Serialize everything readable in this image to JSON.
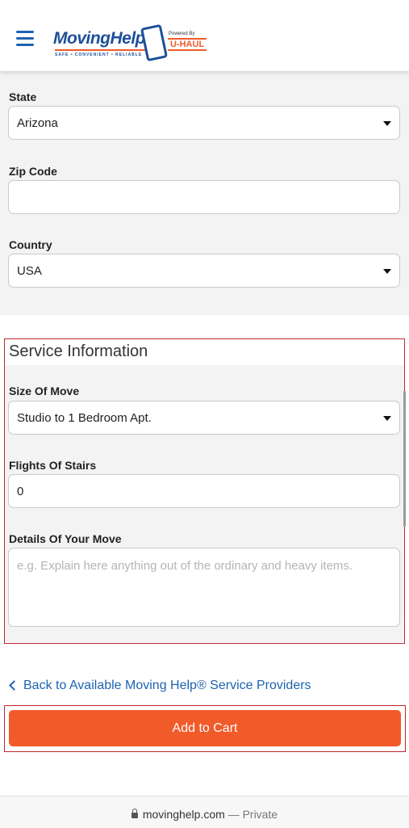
{
  "header": {
    "logo_text": "MovingHelp",
    "tagline": "SAFE • CONVENIENT • RELIABLE",
    "powered_by": "Powered By",
    "partner": "U-HAUL"
  },
  "address": {
    "state_label": "State",
    "state_value": "Arizona",
    "zip_label": "Zip Code",
    "zip_value": "",
    "country_label": "Country",
    "country_value": "USA"
  },
  "service": {
    "title": "Service Information",
    "size_label": "Size Of Move",
    "size_value": "Studio to 1 Bedroom Apt.",
    "stairs_label": "Flights Of Stairs",
    "stairs_value": "0",
    "details_label": "Details Of Your Move",
    "details_placeholder": "e.g. Explain here anything out of the ordinary and heavy items."
  },
  "actions": {
    "back_link": "Back to Available Moving Help® Service Providers",
    "add_to_cart": "Add to Cart"
  },
  "browser": {
    "domain": "movinghelp.com",
    "separator": "—",
    "mode": "Private"
  },
  "colors": {
    "brand_blue": "#1d63b0",
    "accent_orange": "#f15a29",
    "highlight_red": "#c0272d"
  }
}
